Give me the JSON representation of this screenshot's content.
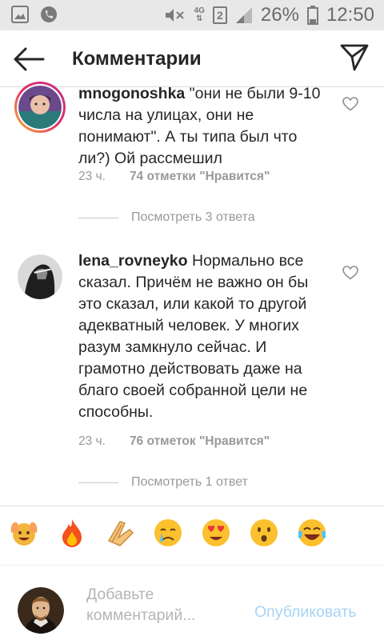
{
  "status_bar": {
    "network_label": "4G",
    "sim_slot": "2",
    "battery_percent": "26%",
    "time": "12:50",
    "icons": [
      "gallery-icon",
      "phone-icon",
      "mute-icon",
      "signal-icon",
      "battery-icon"
    ]
  },
  "header": {
    "title": "Комментарии",
    "back_icon": "arrow-left-icon",
    "send_icon": "direct-send-icon"
  },
  "comments": [
    {
      "username": "mnogonoshka",
      "text": " \"они не были 9-10 числа на улицах, они не понимают\". А ты типа был что ли?) Ой рассмешил",
      "time": "23 ч.",
      "likes": "74 отметки \"Нравится\"",
      "view_replies": "Посмотреть 3 ответа",
      "has_story_ring": true
    },
    {
      "username": "lena_rovneyko",
      "text": " Нормально все сказал. Причём не важно он бы это сказал, или какой то другой адекватный человек. У многих разум замкнуло сейчас. И грамотно действовать даже на благо своей собранной цели не способны.",
      "time": "23 ч.",
      "likes": "76 отметок \"Нравится\"",
      "view_replies": "Посмотреть 1 ответ",
      "has_story_ring": false
    }
  ],
  "reactions": [
    "raising-hands-emoji",
    "fire-emoji",
    "clapping-hands-emoji",
    "crying-emoji",
    "heart-eyes-emoji",
    "surprised-emoji",
    "tears-of-joy-emoji"
  ],
  "composer": {
    "placeholder": "Добавьте комментарий...",
    "publish_label": "Опубликовать"
  },
  "colors": {
    "accent_disabled": "#a8d4f5",
    "story_ring_start": "#f7b733",
    "story_ring_end": "#c13584",
    "meta_gray": "#999999"
  }
}
